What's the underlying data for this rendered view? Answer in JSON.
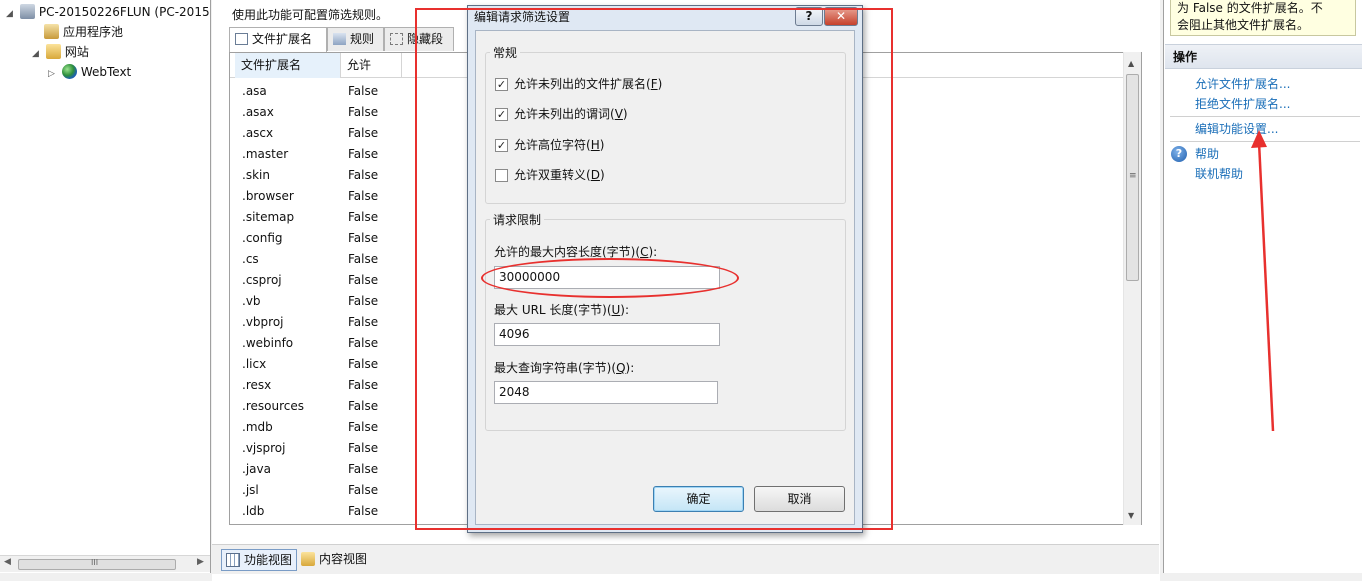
{
  "tree": {
    "items": [
      {
        "label": "PC-20150226FLUN (PC-2015",
        "toggle": "◢",
        "icon": "computer-icon"
      },
      {
        "label": "应用程序池",
        "toggle": "",
        "icon": "app-pool-icon"
      },
      {
        "label": "网站",
        "toggle": "◢",
        "icon": "sites-folder-icon"
      },
      {
        "label": "WebText",
        "toggle": "▷",
        "icon": "globe-icon"
      }
    ],
    "hscroll": {
      "thumb_label": "III"
    }
  },
  "main": {
    "description": "使用此功能可配置筛选规则。",
    "tabs": [
      {
        "label": "文件扩展名",
        "active": true
      },
      {
        "label": "规则",
        "active": false
      },
      {
        "label": "隐藏段",
        "active": false
      }
    ],
    "columns": [
      "文件扩展名",
      "允许"
    ],
    "rows": [
      {
        "ext": ".asa",
        "allowed": "False"
      },
      {
        "ext": ".asax",
        "allowed": "False"
      },
      {
        "ext": ".ascx",
        "allowed": "False"
      },
      {
        "ext": ".master",
        "allowed": "False"
      },
      {
        "ext": ".skin",
        "allowed": "False"
      },
      {
        "ext": ".browser",
        "allowed": "False"
      },
      {
        "ext": ".sitemap",
        "allowed": "False"
      },
      {
        "ext": ".config",
        "allowed": "False"
      },
      {
        "ext": ".cs",
        "allowed": "False"
      },
      {
        "ext": ".csproj",
        "allowed": "False"
      },
      {
        "ext": ".vb",
        "allowed": "False"
      },
      {
        "ext": ".vbproj",
        "allowed": "False"
      },
      {
        "ext": ".webinfo",
        "allowed": "False"
      },
      {
        "ext": ".licx",
        "allowed": "False"
      },
      {
        "ext": ".resx",
        "allowed": "False"
      },
      {
        "ext": ".resources",
        "allowed": "False"
      },
      {
        "ext": ".mdb",
        "allowed": "False"
      },
      {
        "ext": ".vjsproj",
        "allowed": "False"
      },
      {
        "ext": ".java",
        "allowed": "False"
      },
      {
        "ext": ".jsl",
        "allowed": "False"
      },
      {
        "ext": ".ldb",
        "allowed": "False"
      }
    ],
    "bottom_tabs": [
      {
        "label": "功能视图",
        "active": true
      },
      {
        "label": "内容视图",
        "active": false
      }
    ]
  },
  "actions": {
    "tip_lines": [
      "为 False 的文件扩展名。不",
      "会阻止其他文件扩展名。"
    ],
    "title": "操作",
    "links": [
      "允许文件扩展名...",
      "拒绝文件扩展名...",
      "编辑功能设置..."
    ],
    "help": "帮助",
    "online_help": "联机帮助"
  },
  "dialog": {
    "title": "编辑请求筛选设置",
    "help_btn": "?",
    "close_btn": "✕",
    "general_group": "常规",
    "options": [
      {
        "label": "允许未列出的文件扩展名",
        "key": "F",
        "checked": true
      },
      {
        "label": "允许未列出的谓词",
        "key": "V",
        "checked": true
      },
      {
        "label": "允许高位字符",
        "key": "H",
        "checked": true
      },
      {
        "label": "允许双重转义",
        "key": "D",
        "checked": false
      }
    ],
    "limits_group": "请求限制",
    "fields": [
      {
        "label": "允许的最大内容长度(字节)",
        "key": "C",
        "value": "30000000"
      },
      {
        "label": "最大 URL 长度(字节)",
        "key": "U",
        "value": "4096"
      },
      {
        "label": "最大查询字符串(字节)",
        "key": "Q",
        "value": "2048"
      }
    ],
    "ok": "确定",
    "cancel": "取消"
  },
  "colors": {
    "annotation_red": "#e8302e",
    "link_blue": "#1a6eb8",
    "dialog_frame": "#dfe8f3"
  }
}
